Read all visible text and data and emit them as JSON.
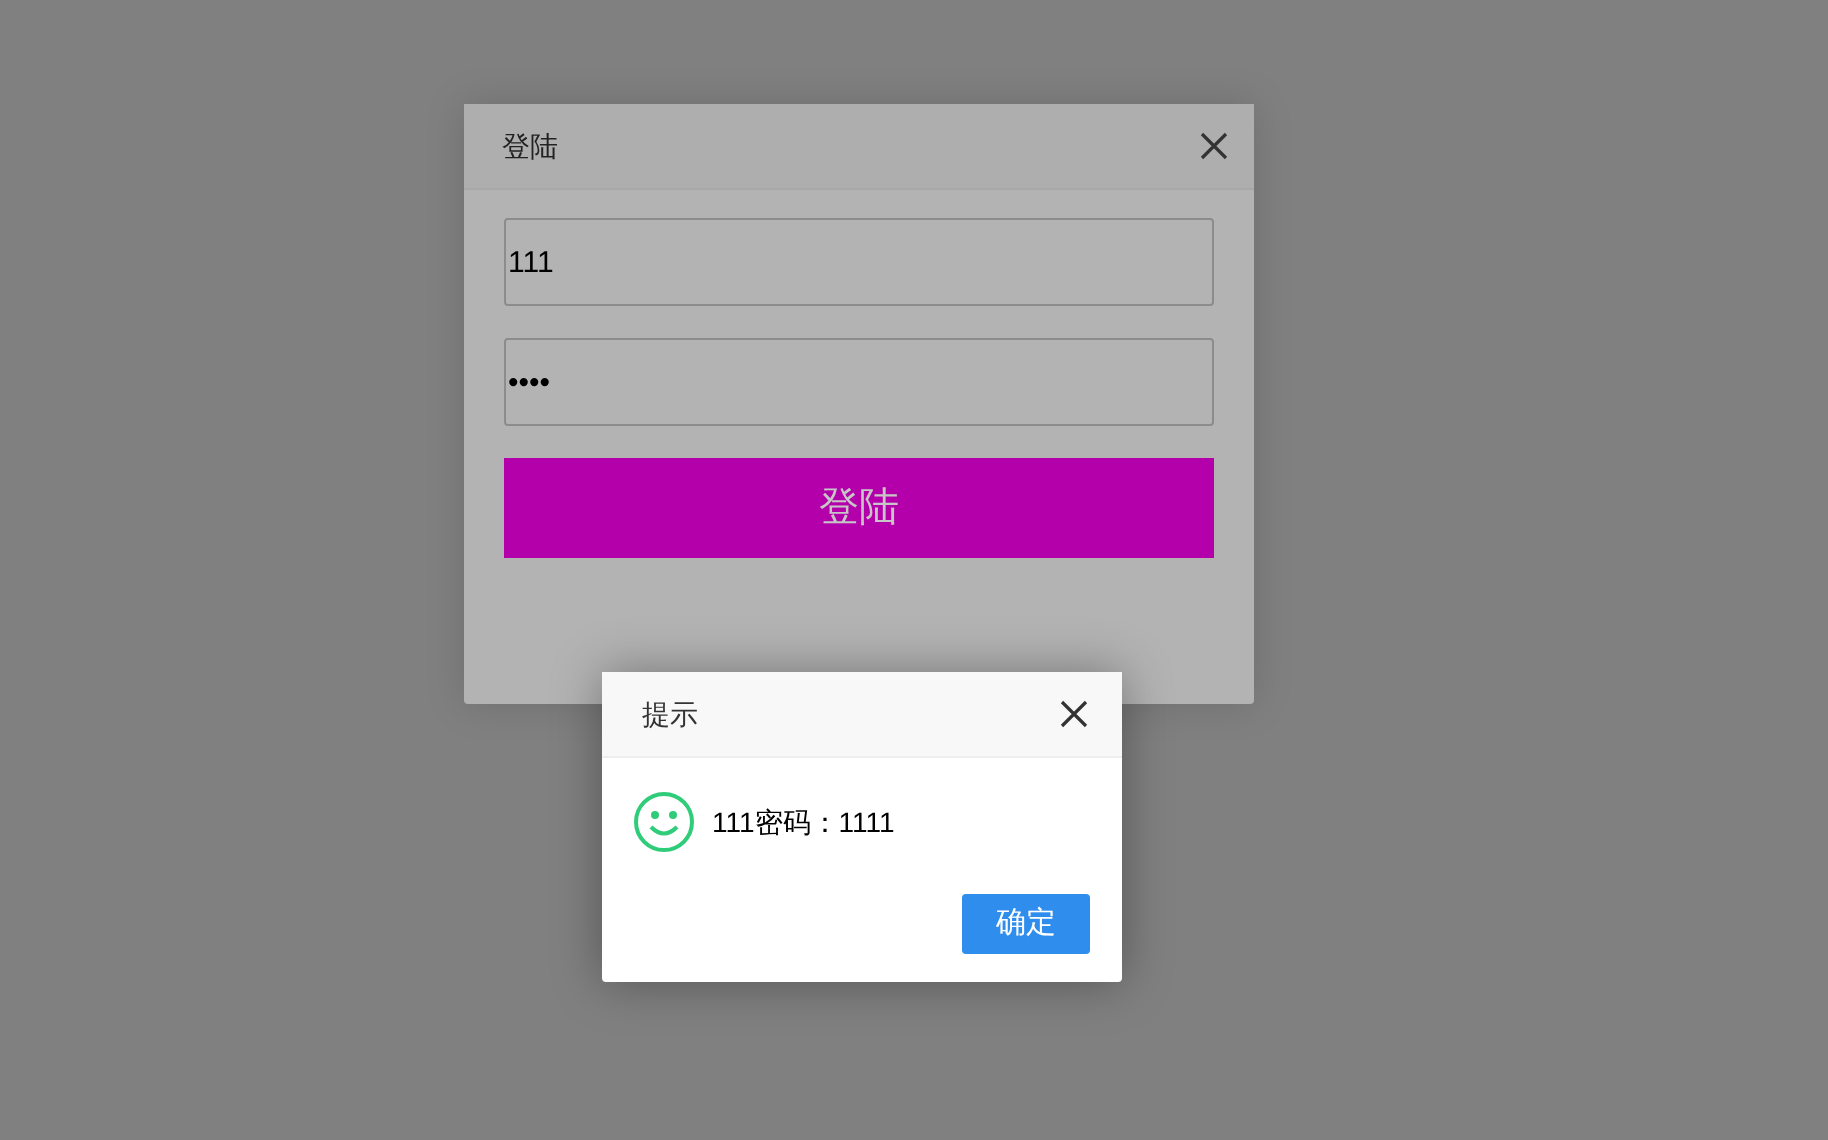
{
  "login_dialog": {
    "title": "登陆",
    "username": {
      "value": "111"
    },
    "password": {
      "value": "••••"
    },
    "submit": "登陆"
  },
  "alert_dialog": {
    "title": "提示",
    "message": "111密码：1111",
    "ok": "确定"
  }
}
